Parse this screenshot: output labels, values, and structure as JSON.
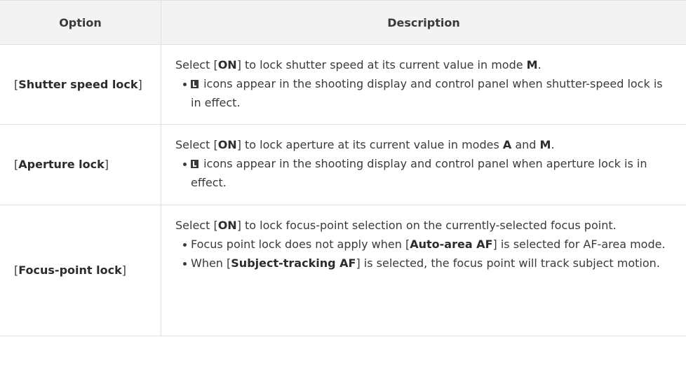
{
  "header": {
    "option": "Option",
    "description": "Description"
  },
  "rows": [
    {
      "option_open": "[",
      "option_name": "Shutter speed lock",
      "option_close": "]",
      "desc_a": "Select [",
      "desc_on": "ON",
      "desc_b": "] to lock shutter speed at its current value in mode ",
      "desc_mode1": "M",
      "desc_c": ".",
      "bullet1_icon": "lock-icon",
      "bullet1_text": " icons appear in the shooting display and control panel when shutter-speed lock is in effect."
    },
    {
      "option_open": "[",
      "option_name": "Aperture lock",
      "option_close": "]",
      "desc_a": "Select [",
      "desc_on": "ON",
      "desc_b": "] to lock aperture at its current value in modes ",
      "desc_mode1": "A",
      "desc_and": " and ",
      "desc_mode2": "M",
      "desc_c": ".",
      "bullet1_icon": "lock-icon",
      "bullet1_text": " icons appear in the shooting display and control panel when aperture lock is in effect."
    },
    {
      "option_open": "[",
      "option_name": "Focus-point lock",
      "option_close": "]",
      "desc_a": "Select [",
      "desc_on": "ON",
      "desc_b": "] to lock focus-point selection on the currently-selected focus point.",
      "bullet1_a": "Focus point lock does not apply when [",
      "bullet1_bold": "Auto-area AF",
      "bullet1_b": "] is selected for AF-area mode.",
      "bullet2_a": "When [",
      "bullet2_bold": "Subject-tracking AF",
      "bullet2_b": "] is selected, the focus point will track subject motion."
    }
  ]
}
